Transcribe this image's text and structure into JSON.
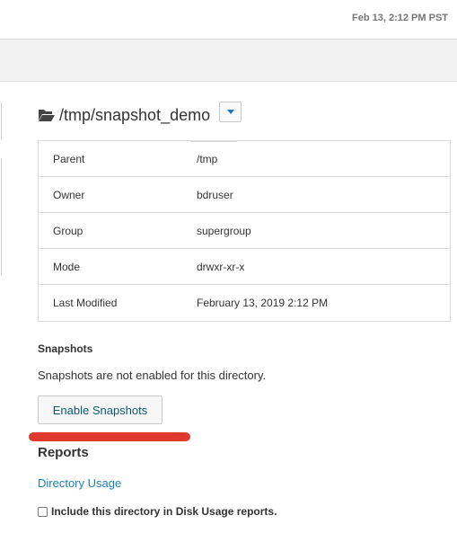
{
  "header": {
    "timestamp": "Feb 13, 2:12 PM PST"
  },
  "directory": {
    "path": "/tmp/snapshot_demo",
    "properties": [
      {
        "key": "Parent",
        "value": "/tmp"
      },
      {
        "key": "Owner",
        "value": "bdruser"
      },
      {
        "key": "Group",
        "value": "supergroup"
      },
      {
        "key": "Mode",
        "value": "drwxr-xr-x"
      },
      {
        "key": "Last Modified",
        "value": "February 13, 2019 2:12 PM"
      }
    ]
  },
  "snapshots": {
    "heading": "Snapshots",
    "status_text": "Snapshots are not enabled for this directory.",
    "enable_button": "Enable Snapshots"
  },
  "reports": {
    "heading": "Reports",
    "directory_usage_link": "Directory Usage",
    "include_checkbox_label": "Include this directory in Disk Usage reports.",
    "include_checked": false
  },
  "colors": {
    "link": "#1a7fb8",
    "annotation_red": "#e03a2f",
    "caret_blue": "#1a73c7"
  },
  "icons": {
    "folder": "folder-open-icon",
    "dropdown": "caret-down-icon"
  }
}
